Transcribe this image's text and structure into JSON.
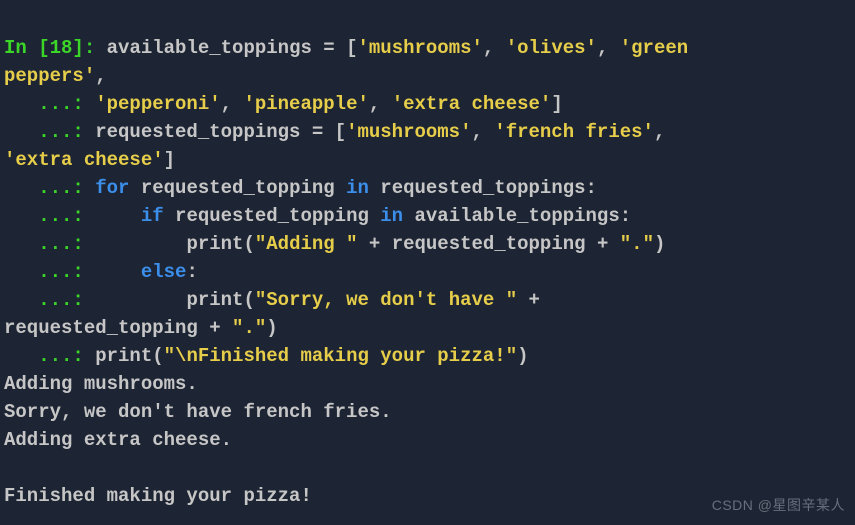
{
  "cell": {
    "in_label": "In [",
    "in_num": "18",
    "in_close": "]: ",
    "cont": "   ...: ",
    "code": {
      "l1a": "available_toppings = [",
      "s_mush": "'mushrooms'",
      "s_oliv": "'olives'",
      "s_greenp": "'green ",
      "s_peppers2": "peppers'",
      "s_pepperoni": "'pepperoni'",
      "s_pineapple": "'pineapple'",
      "s_extra": "'extra cheese'",
      "l2a": "requested_toppings = [",
      "s_fries": "'french fries'",
      "s_extra2_a": "'extra cheese'",
      "kw_for": "for",
      "id_reqtop": " requested_topping ",
      "kw_in": "in",
      "id_reqtops": " requested_toppings:",
      "kw_if": "if",
      "id_reqtop2": " requested_topping ",
      "kw_in2": "in",
      "id_availtops": " available_toppings:",
      "fn_print": "print",
      "s_adding": "\"Adding \"",
      "plus": " + ",
      "id_reqtop3": "requested_topping",
      "s_dot": "\".\"",
      "kw_else": "else",
      "colon": ":",
      "s_sorry": "\"Sorry, we don't have \"",
      "id_reqtop4a": "requested_topping ",
      "s_dot2": "\".\"",
      "s_finished": "\"\\nFinished making your pizza!\"",
      "comma": ", ",
      "rbr": "]",
      "lpar": "(",
      "rpar": ")",
      "indent4": "    ",
      "indent8": "        ",
      "indent12": "            "
    }
  },
  "output": {
    "l1": "Adding mushrooms.",
    "l2": "Sorry, we don't have french fries.",
    "l3": "Adding extra cheese.",
    "l4": "",
    "l5": "Finished making your pizza!"
  },
  "watermark": "CSDN @星图辛某人"
}
